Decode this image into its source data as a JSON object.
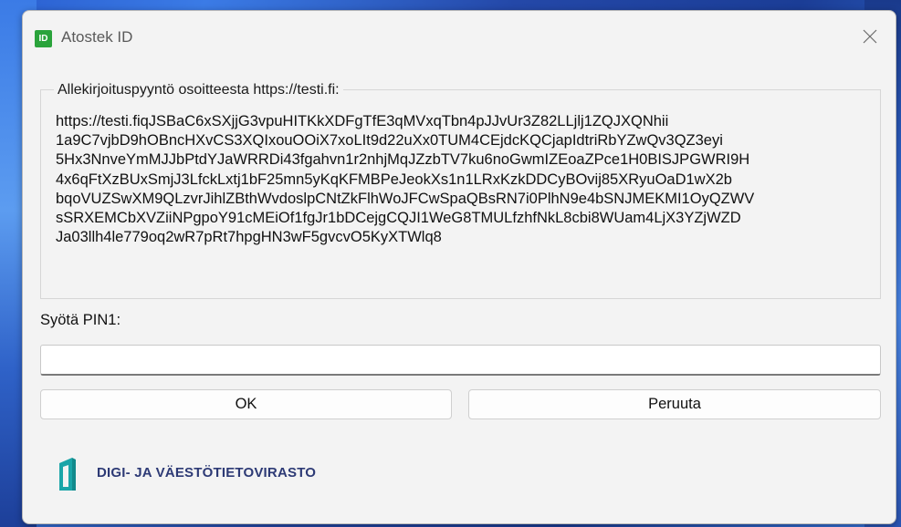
{
  "window": {
    "title": "Atostek ID",
    "app_icon_text": "ID"
  },
  "request": {
    "caption": "Allekirjoituspyyntö osoitteesta https://testi.fi:",
    "lines": [
      "https://testi.fiqJSBaC6xSXjjG3vpuHITKkXDFgTfE3qMVxqTbn4pJJvUr3Z82LLjlj1ZQJXQNhii",
      "1a9C7vjbD9hOBncHXvCS3XQIxouOOiX7xoLIt9d22uXx0TUM4CEjdcKQCjapIdtriRbYZwQv3QZ3eyi",
      "5Hx3NnveYmMJJbPtdYJaWRRDi43fgahvn1r2nhjMqJZzbTV7ku6noGwmIZEoaZPce1H0BISJPGWRI9H",
      "4x6qFtXzBUxSmjJ3LfckLxtj1bF25mn5yKqKFMBPeJeokXs1n1LRxKzkDDCyBOvij85XRyuOaD1wX2b",
      "bqoVUZSwXM9QLzvrJihlZBthWvdoslpCNtZkFlhWoJFCwSpaQBsRN7i0PlhN9e4bSNJMEKMI1OyQZWV",
      "sSRXEMCbXVZiiNPgpoY91cMEiOf1fgJr1bDCejgCQJI1WeG8TMULfzhfNkL8cbi8WUam4LjX3YZjWZD",
      "Ja03llh4le779oq2wR7pRt7hpgHN3wF5gvcvO5KyXTWlq8"
    ]
  },
  "pin": {
    "label": "Syötä PIN1:",
    "value": ""
  },
  "buttons": {
    "ok": "OK",
    "cancel": "Peruuta"
  },
  "logo": {
    "text": "DIGI- JA VÄESTÖTIETOVIRASTO"
  },
  "colors": {
    "logo_teal": "#1aa5a8",
    "logo_navy": "#2d3a75",
    "app_green": "#2aa33b"
  }
}
